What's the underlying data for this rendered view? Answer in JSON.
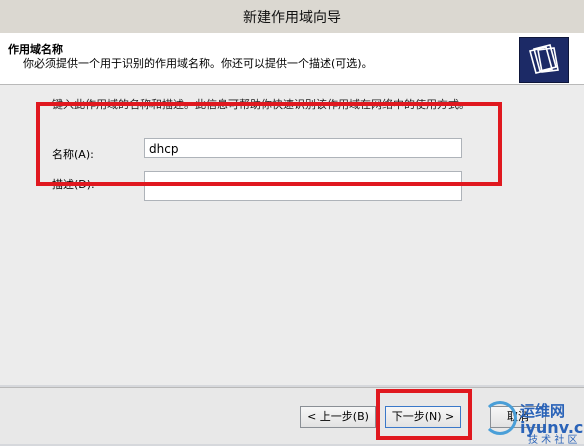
{
  "window": {
    "title": "新建作用域向导"
  },
  "header": {
    "title": "作用域名称",
    "subtitle": "你必须提供一个用于识别的作用域名称。你还可以提供一个描述(可选)。",
    "icon": "wizard-folder-icon"
  },
  "body": {
    "intro": "键入此作用域的名称和描述。此信息可帮助你快速识别该作用域在网络中的使用方式。",
    "name_label": "名称(A):",
    "name_value": "dhcp",
    "description_label": "描述(D):",
    "description_value": ""
  },
  "footer": {
    "back_label": "< 上一步(B)",
    "next_label": "下一步(N) >",
    "cancel_label": "取消"
  },
  "watermark": {
    "line1": "运维网",
    "line2": "iyunv.com",
    "line3": "技 术 社 区"
  },
  "colors": {
    "highlight": "#e0181f",
    "header_icon_bg": "#1c2a66"
  }
}
